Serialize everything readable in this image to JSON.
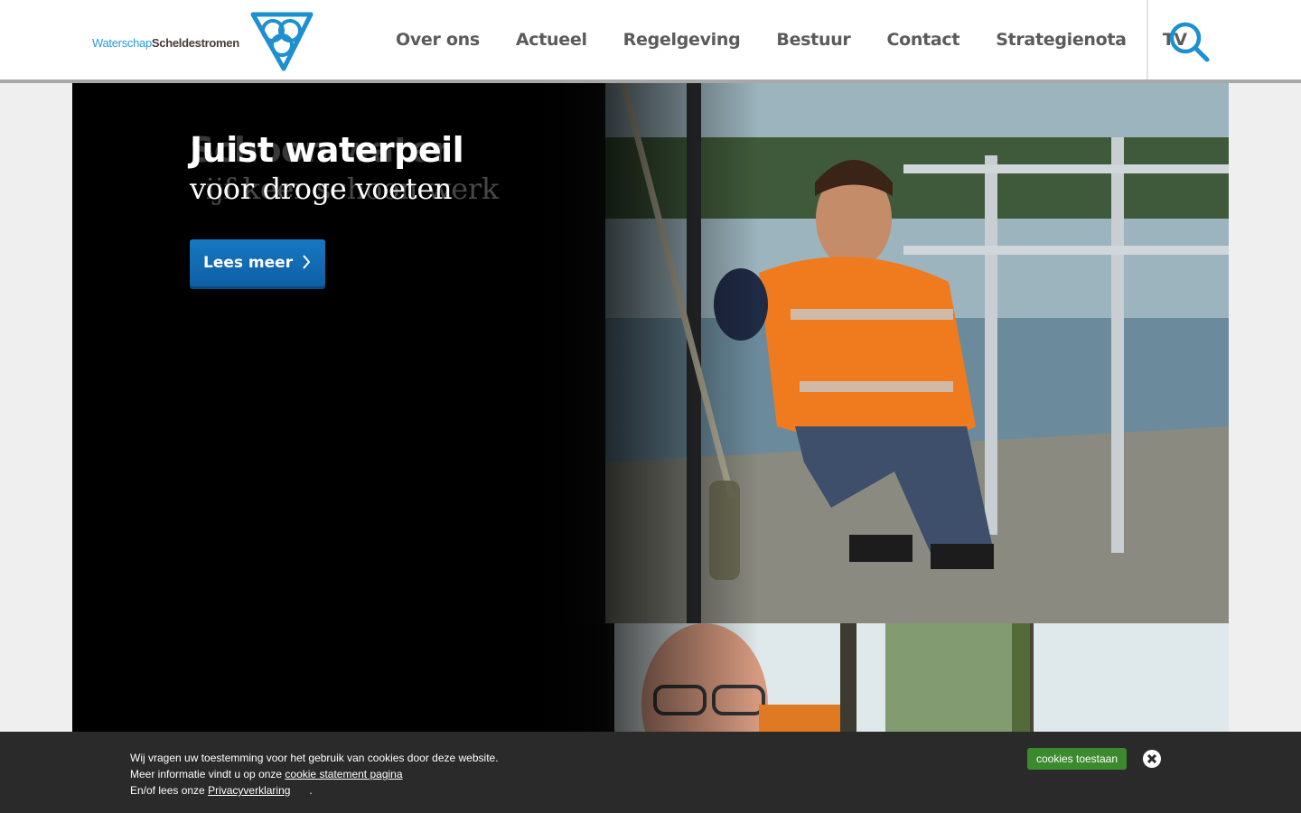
{
  "header": {
    "logo": {
      "text_part1": "Waterschap",
      "text_part2": "Scheldestromen",
      "color_blue": "#2b9bd8",
      "color_dark": "#4a3b37"
    },
    "nav": [
      {
        "label": "Over ons"
      },
      {
        "label": "Actueel"
      },
      {
        "label": "Regelgeving"
      },
      {
        "label": "Bestuur"
      },
      {
        "label": "Contact"
      },
      {
        "label": "Strategienota"
      },
      {
        "label": "TV"
      }
    ],
    "search_icon": "search-icon"
  },
  "hero": {
    "title": "Juist waterpeil",
    "subtitle": "voor droge voeten",
    "ghost_title": "Schoon water",
    "ghost_subtitle": "vijf keer schoon werk",
    "button_label": "Lees meer",
    "button_color": "#1678c2"
  },
  "cookie": {
    "line1": "Wij vragen uw toestemming voor het gebruik van cookies door deze website.",
    "line2_prefix": "Meer informatie vindt u op onze ",
    "line2_link": "cookie statement pagina",
    "line3_prefix": "En/of lees onze ",
    "line3_link": "Privacyverklaring",
    "line3_suffix": ".",
    "accept_label": "cookies toestaan",
    "accept_color": "#3c8a2e",
    "close_icon": "close-circle-icon"
  }
}
